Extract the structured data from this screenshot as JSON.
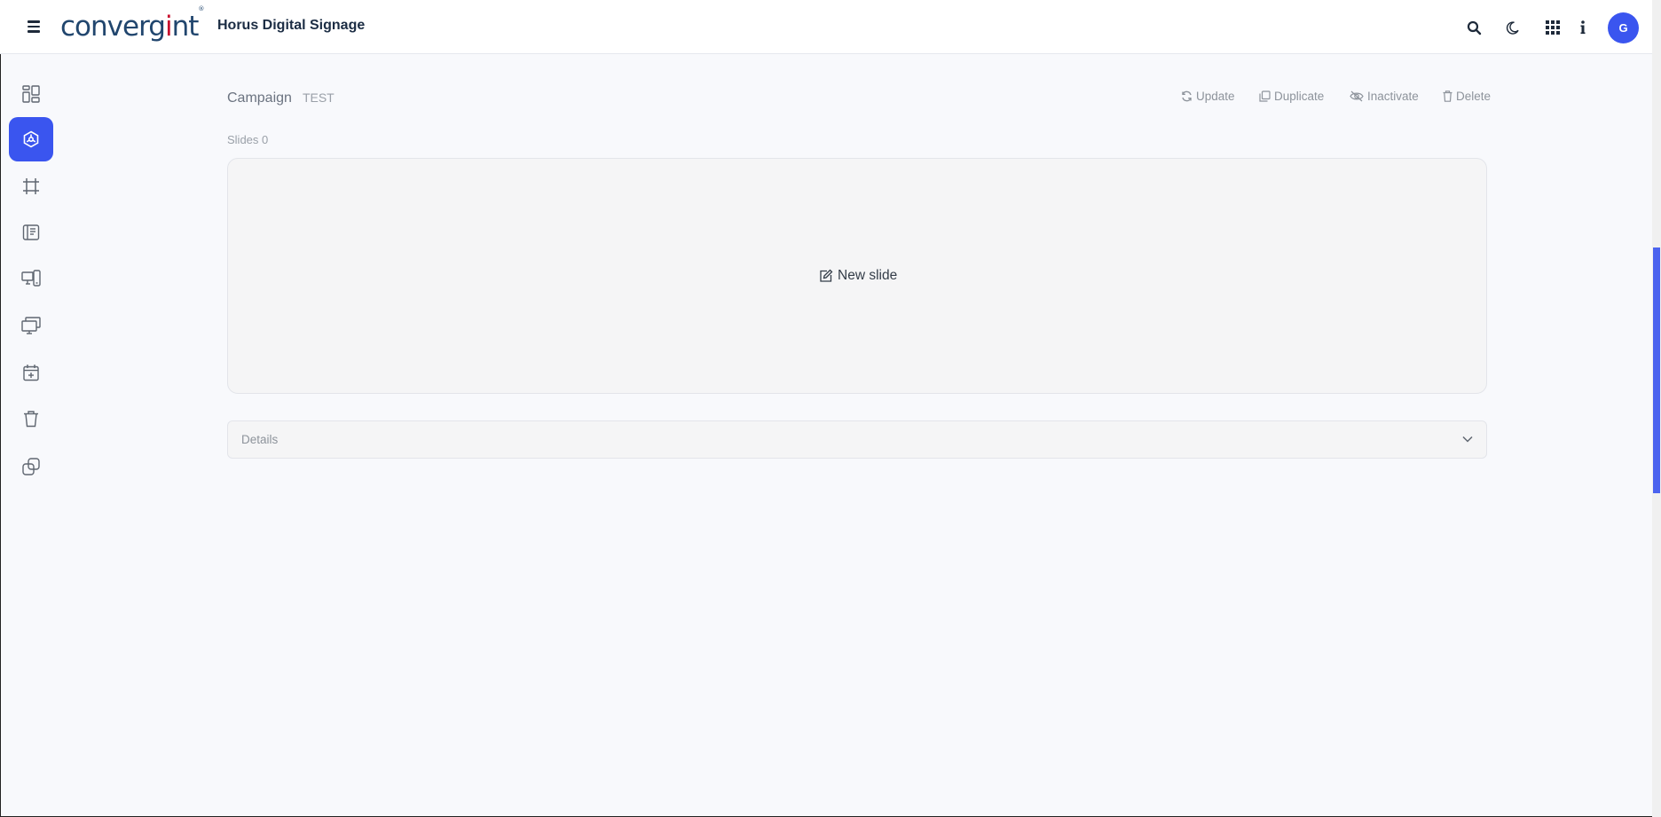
{
  "header": {
    "menu_icon": "hamburger-icon",
    "logo_text_pre": "converg",
    "logo_text_i": "i",
    "logo_text_post": "nt",
    "logo_tm": "®",
    "app_title": "Horus Digital Signage",
    "icons": [
      "search-icon",
      "moon-icon",
      "apps-grid-icon",
      "info-icon"
    ],
    "avatar_initial": "G",
    "brand_color": "#3a55ef"
  },
  "sidebar": {
    "items": [
      {
        "icon": "dashboard-icon",
        "active": false
      },
      {
        "icon": "campaign-icon",
        "active": true
      },
      {
        "icon": "frame-icon",
        "active": false
      },
      {
        "icon": "content-icon",
        "active": false
      },
      {
        "icon": "devices-icon",
        "active": false
      },
      {
        "icon": "screens-icon",
        "active": false
      },
      {
        "icon": "calendar-add-icon",
        "active": false
      },
      {
        "icon": "trash-icon",
        "active": false
      },
      {
        "icon": "link-icon",
        "active": false
      }
    ]
  },
  "page": {
    "label": "Campaign",
    "name": "TEST",
    "actions": {
      "update": "Update",
      "duplicate": "Duplicate",
      "inactivate": "Inactivate",
      "delete": "Delete"
    },
    "slides_label": "Slides 0",
    "new_slide": "New slide",
    "details_label": "Details"
  }
}
